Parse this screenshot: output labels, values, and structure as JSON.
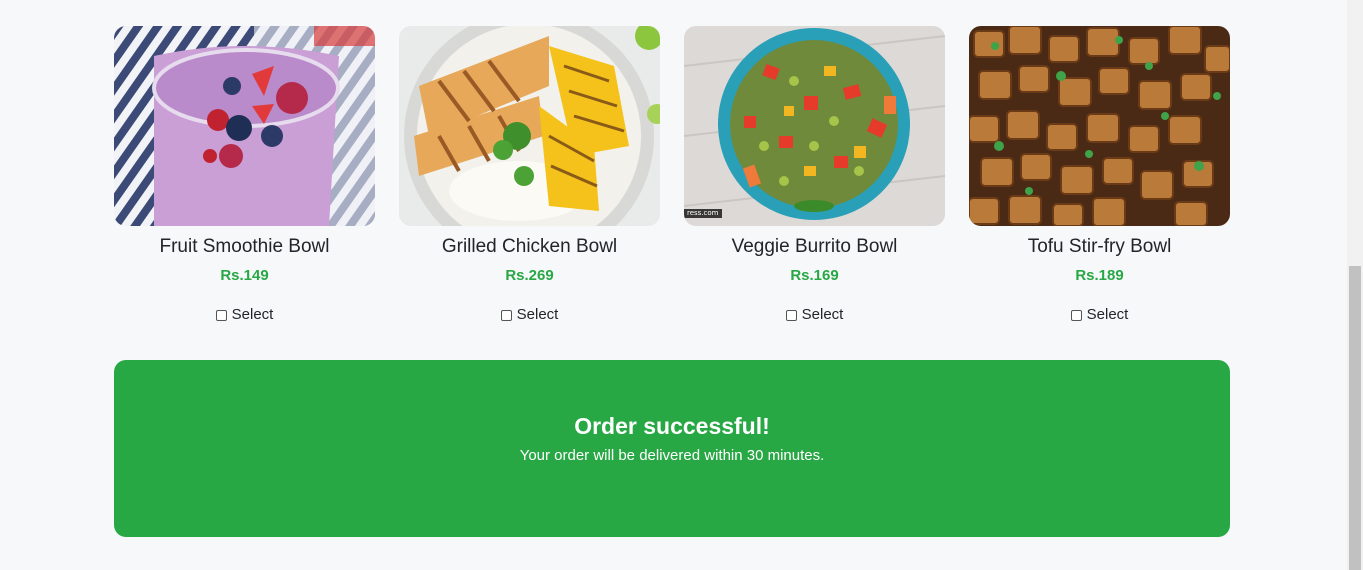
{
  "menu": {
    "items": [
      {
        "name": "Fruit Smoothie Bowl",
        "price": "Rs.149",
        "select_label": "Select",
        "image_icon": "fruit-smoothie-photo"
      },
      {
        "name": "Grilled Chicken Bowl",
        "price": "Rs.269",
        "select_label": "Select",
        "image_icon": "grilled-chicken-photo"
      },
      {
        "name": "Veggie Burrito Bowl",
        "price": "Rs.169",
        "select_label": "Select",
        "image_icon": "veggie-burrito-photo",
        "image_watermark": "ress.com"
      },
      {
        "name": "Tofu Stir-fry Bowl",
        "price": "Rs.189",
        "select_label": "Select",
        "image_icon": "tofu-stirfry-photo"
      }
    ]
  },
  "order_banner": {
    "title": "Order successful!",
    "message": "Your order will be delivered within 30 minutes.",
    "color": "#28a745"
  },
  "colors": {
    "price": "#28a745",
    "background": "#f7f8fa"
  }
}
